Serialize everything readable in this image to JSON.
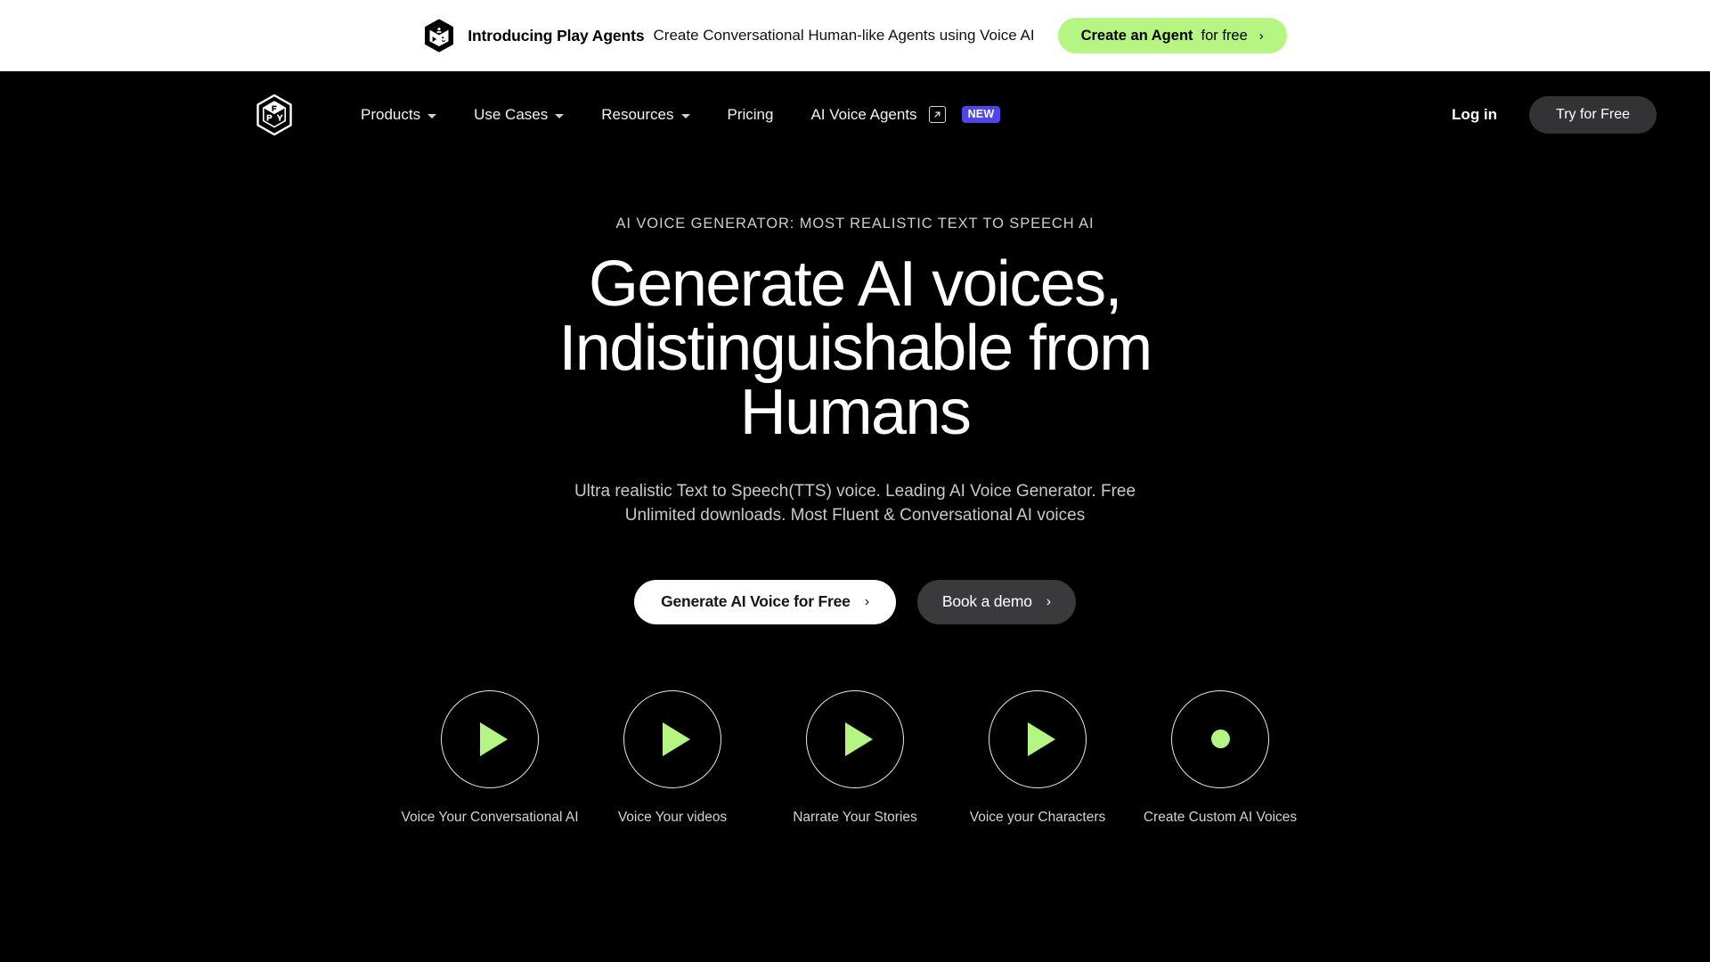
{
  "announcement": {
    "logo_icon": "play-agents-cube-icon",
    "title": "Introducing Play Agents",
    "subtitle": "Create Conversational Human-like Agents using Voice AI",
    "cta_strong": "Create an Agent",
    "cta_light": "for free",
    "cta_chevron": "›",
    "bg_color": "#ffffff",
    "cta_color": "#b4f583"
  },
  "navbar": {
    "logo_icon": "playht-cube-logo",
    "items": [
      {
        "label": "Products",
        "has_caret": true
      },
      {
        "label": "Use Cases",
        "has_caret": true
      },
      {
        "label": "Resources",
        "has_caret": true
      },
      {
        "label": "Pricing",
        "has_caret": false
      },
      {
        "label": "AI Voice Agents",
        "has_caret": false,
        "external": true,
        "badge": "NEW"
      }
    ],
    "login_label": "Log in",
    "try_free_label": "Try for Free",
    "badge_color": "#4f46e5"
  },
  "hero": {
    "eyebrow": "AI VOICE GENERATOR: MOST REALISTIC TEXT TO SPEECH AI",
    "headline": "Generate AI voices, Indistinguishable from Humans",
    "subheadline": "Ultra realistic Text to Speech(TTS) voice. Leading AI Voice Generator. Free Unlimited downloads. Most Fluent & Conversational AI voices",
    "primary_cta": "Generate AI Voice for Free",
    "secondary_cta": "Book a demo",
    "chevron": "›"
  },
  "use_cases": {
    "accent_color": "#b4f583",
    "items": [
      {
        "label": "Voice Your Conversational AI",
        "icon": "play-icon"
      },
      {
        "label": "Voice Your videos",
        "icon": "play-icon"
      },
      {
        "label": "Narrate Your Stories",
        "icon": "play-icon"
      },
      {
        "label": "Voice your Characters",
        "icon": "play-icon"
      },
      {
        "label": "Create Custom AI Voices",
        "icon": "record-dot-icon"
      }
    ]
  }
}
